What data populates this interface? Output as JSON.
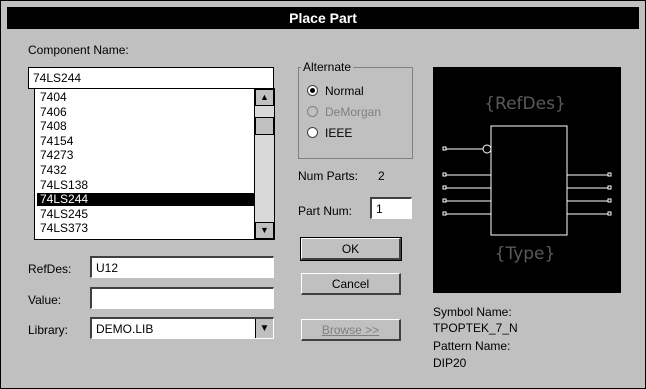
{
  "dialog": {
    "title": "Place Part"
  },
  "component": {
    "label": "Component Name:",
    "value": "74LS244",
    "list": [
      "7404",
      "7406",
      "7408",
      "74154",
      "74273",
      "7432",
      "74LS138",
      "74LS244",
      "74LS245",
      "74LS373"
    ],
    "selected_index": 7
  },
  "alternate": {
    "title": "Alternate",
    "options": [
      "Normal",
      "DeMorgan",
      "IEEE"
    ],
    "selected": "Normal",
    "disabled": [
      "DeMorgan"
    ]
  },
  "num_parts": {
    "label": "Num Parts:",
    "value": "2"
  },
  "part_num": {
    "label": "Part Num:",
    "value": "1"
  },
  "buttons": {
    "ok": "OK",
    "cancel": "Cancel",
    "browse": "Browse >>"
  },
  "refdes": {
    "label": "RefDes:",
    "value": "U12"
  },
  "value_field": {
    "label": "Value:",
    "value": ""
  },
  "library": {
    "label": "Library:",
    "value": "DEMO.LIB"
  },
  "preview": {
    "refdes_text": "{RefDes}",
    "type_text": "{Type}",
    "outline_color": "#ffffff"
  },
  "symbol": {
    "name_label": "Symbol Name:",
    "name": "TPOPTEK_7_N",
    "pattern_label": "Pattern Name:",
    "pattern": "DIP20"
  },
  "icons": {
    "scroll_up": "scroll-up-arrow-icon",
    "scroll_down": "scroll-down-arrow-icon",
    "dropdown": "dropdown-arrow-icon"
  }
}
